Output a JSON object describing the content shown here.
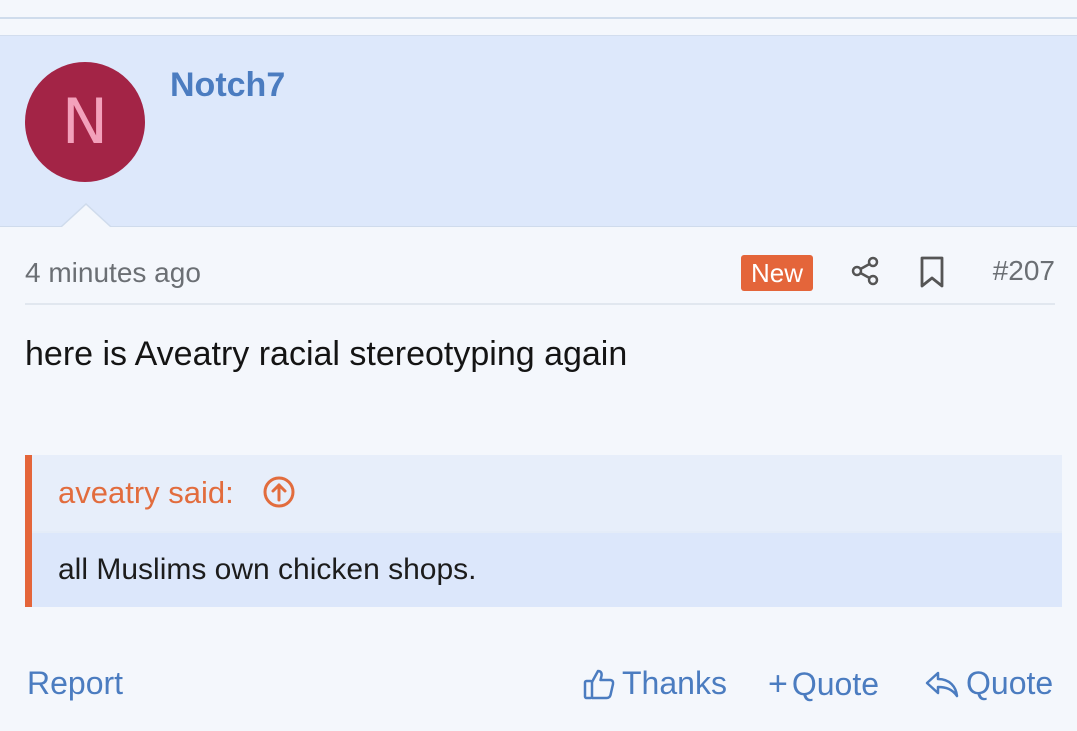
{
  "post": {
    "username": "Notch7",
    "avatar_letter": "N",
    "avatar_color": "#a32446",
    "timestamp": "4 minutes ago",
    "badge_new": "New",
    "post_number": "#207",
    "body": "here is Aveatry racial stereotyping again",
    "quote": {
      "author_label": "aveatry said:",
      "text": "all Muslims own chicken shops."
    }
  },
  "actions": {
    "report": "Report",
    "thanks": "Thanks",
    "multi_quote": "Quote",
    "reply_quote": "Quote"
  },
  "icons": {
    "share": "share-icon",
    "bookmark": "bookmark-icon",
    "quote_jump": "arrow-up-circle-icon",
    "thanks": "thumbs-up-icon",
    "multi_quote": "plus-icon",
    "reply_quote": "reply-icon"
  },
  "colors": {
    "accent_blue": "#4b7cc0",
    "accent_orange": "#e4653a",
    "header_bg": "#dde8fb"
  }
}
